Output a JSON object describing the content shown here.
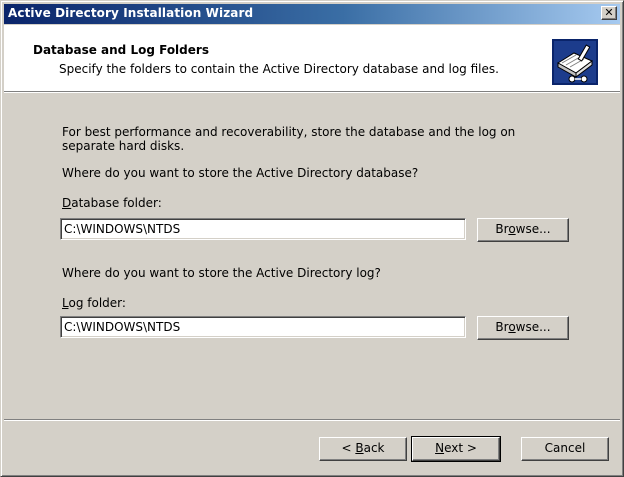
{
  "window": {
    "title": "Active Directory Installation Wizard",
    "close_glyph": "✕"
  },
  "header": {
    "title": "Database and Log Folders",
    "subtitle": "Specify the folders to contain the Active Directory database and log files.",
    "icon": "directory-book-icon"
  },
  "body": {
    "intro": "For best performance and recoverability, store the database and the log on separate hard disks.",
    "db_question": "Where do you want to store the Active Directory database?",
    "db_label_hotkey": "D",
    "db_label_rest": "atabase folder:",
    "db_value": "C:\\WINDOWS\\NTDS",
    "db_browse_pre": "Br",
    "db_browse_hotkey": "o",
    "db_browse_post": "wse...",
    "log_question": "Where do you want to store the Active Directory log?",
    "log_label_hotkey": "L",
    "log_label_rest": "og folder:",
    "log_value": "C:\\WINDOWS\\NTDS",
    "log_browse_pre": "Br",
    "log_browse_hotkey": "o",
    "log_browse_post": "wse..."
  },
  "footer": {
    "back_pre": "< ",
    "back_hotkey": "B",
    "back_post": "ack",
    "next_hotkey": "N",
    "next_post": "ext >",
    "cancel": "Cancel"
  },
  "colors": {
    "title_start": "#0a246a",
    "title_end": "#a6caf0",
    "face": "#d4d0c8"
  }
}
